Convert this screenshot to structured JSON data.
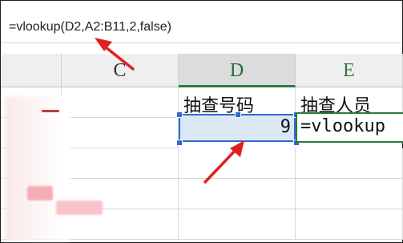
{
  "formula_bar": {
    "text": "=vlookup(D2,A2:B11,2,false)"
  },
  "columns": [
    {
      "label": "C"
    },
    {
      "label": "D"
    },
    {
      "label": "E"
    }
  ],
  "row1": {
    "d": "抽查号码",
    "e": "抽查人员"
  },
  "row2": {
    "d": "9",
    "e": "=vlookup"
  },
  "colors": {
    "selection_border": "#2e6ad0",
    "selection_fill": "#dce7f6",
    "active_header_border": "#2b7a43",
    "arrow": "#e02020"
  },
  "icons": [
    "red-arrow-annotation",
    "red-arrow-annotation"
  ]
}
